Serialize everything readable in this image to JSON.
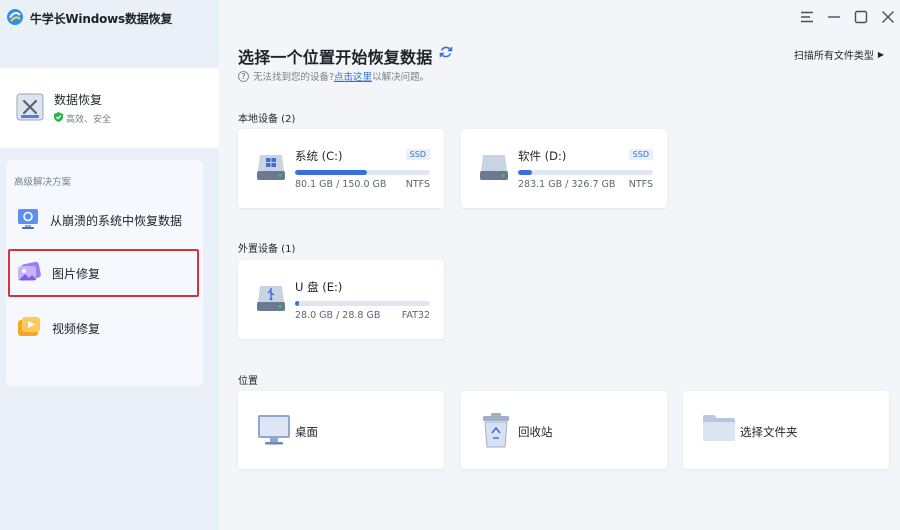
{
  "app": {
    "title": "牛学长Windows数据恢复"
  },
  "sidebar": {
    "recover": {
      "title": "数据恢复",
      "subtitle": "高效、安全"
    },
    "advanced": {
      "heading": "高级解决方案",
      "items": [
        {
          "label": "从崩溃的系统中恢复数据",
          "icon": "crashed-system-icon"
        },
        {
          "label": "图片修复",
          "icon": "photo-repair-icon",
          "selected": true
        },
        {
          "label": "视频修复",
          "icon": "video-repair-icon"
        }
      ]
    }
  },
  "window": {
    "controls": [
      "menu-icon",
      "minimize-icon",
      "maximize-icon",
      "close-icon"
    ]
  },
  "main": {
    "heading": "选择一个位置开始恢复数据",
    "hint": {
      "prefix": "无法找到您的设备?",
      "link": "点击这里",
      "suffix": "以解决问题。"
    },
    "scan_all": "扫描所有文件类型",
    "local_title": "本地设备 (2)",
    "external_title": "外置设备 (1)",
    "location_title": "位置",
    "local_drives": [
      {
        "name": "系统 (C:)",
        "badge": "SSD",
        "size": "80.1 GB / 150.0 GB",
        "fs": "NTFS",
        "used_fraction": 0.534
      },
      {
        "name": "软件 (D:)",
        "badge": "SSD",
        "size": "283.1 GB / 326.7 GB",
        "fs": "NTFS",
        "used_fraction": 0.1
      }
    ],
    "external_drives": [
      {
        "name": "U 盘 (E:)",
        "size": "28.0 GB / 28.8 GB",
        "fs": "FAT32",
        "used_fraction": 0.03
      }
    ],
    "locations": [
      {
        "label": "桌面",
        "icon": "desktop-icon"
      },
      {
        "label": "回收站",
        "icon": "recycle-bin-icon"
      },
      {
        "label": "选择文件夹",
        "icon": "folder-icon"
      }
    ]
  },
  "colors": {
    "accent": "#3b6fe0",
    "sidebar_bg": "#e9f0f8",
    "main_bg": "#f3f5f8",
    "selected_border": "#d9323a"
  }
}
